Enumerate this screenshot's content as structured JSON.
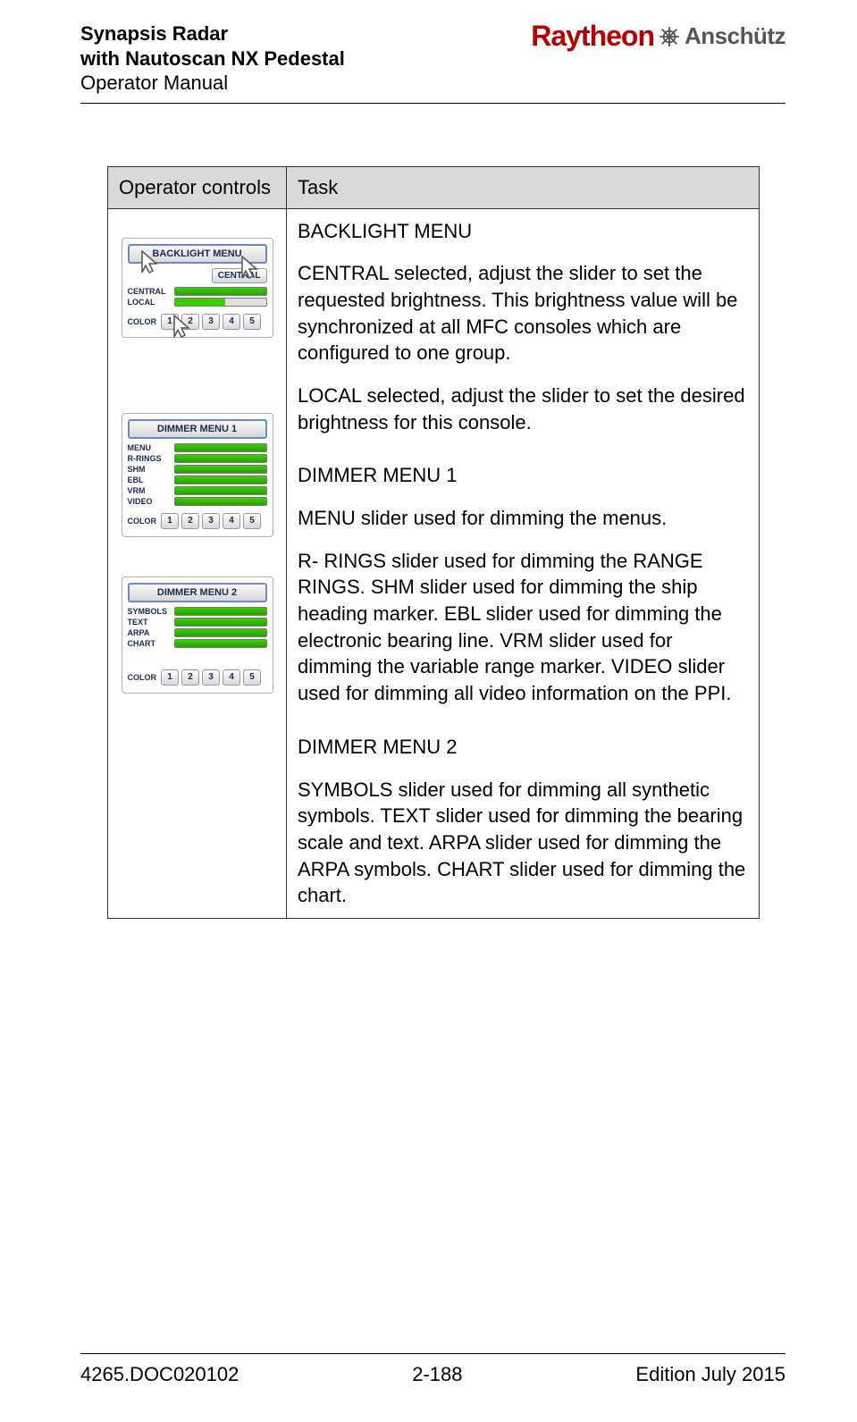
{
  "header": {
    "title_line1": "Synapsis Radar",
    "title_line2": "with Nautoscan NX Pedestal",
    "subtitle": "Operator Manual",
    "logo_ray": "Raytheon",
    "logo_an": "Anschütz"
  },
  "table": {
    "col1_header": "Operator controls",
    "col2_header": "Task"
  },
  "panels": {
    "backlight": {
      "title": "BACKLIGHT MENU",
      "tab": "CENTRAL",
      "rows": [
        "CENTRAL",
        "LOCAL"
      ],
      "color_label": "COLOR",
      "color_buttons": [
        "1",
        "2",
        "3",
        "4",
        "5"
      ]
    },
    "dimmer1": {
      "title": "DIMMER MENU 1",
      "rows": [
        "MENU",
        "R-RINGS",
        "SHM",
        "EBL",
        "VRM",
        "VIDEO"
      ],
      "color_label": "COLOR",
      "color_buttons": [
        "1",
        "2",
        "3",
        "4",
        "5"
      ]
    },
    "dimmer2": {
      "title": "DIMMER MENU 2",
      "rows": [
        "SYMBOLS",
        "TEXT",
        "ARPA",
        "CHART"
      ],
      "color_label": "COLOR",
      "color_buttons": [
        "1",
        "2",
        "3",
        "4",
        "5"
      ]
    }
  },
  "task": {
    "h1": "BACKLIGHT MENU",
    "p1": "CENTRAL selected, adjust the slider to set the requested brightness. This brightness value will be synchronized at all MFC consoles which are configured to one group.",
    "p2": "LOCAL selected, adjust the slider to set the desired brightness for this console.",
    "h2": "DIMMER MENU 1",
    "p3": "MENU slider used for dimming the menus.",
    "p4": "R- RINGS slider used for dimming the RANGE RINGS. SHM slider used for dimming the ship heading marker. EBL slider used for dimming the electronic bearing line. VRM slider used for dimming the variable range marker. VIDEO slider used for dimming all video information on the PPI.",
    "h3": "DIMMER MENU 2",
    "p5": "SYMBOLS slider used for dimming all synthetic symbols. TEXT slider used for dimming the bearing scale and text. ARPA slider used for dimming the ARPA symbols. CHART slider used for dimming the chart."
  },
  "footer": {
    "left": "4265.DOC020102",
    "center": "2-188",
    "right": "Edition July 2015"
  }
}
